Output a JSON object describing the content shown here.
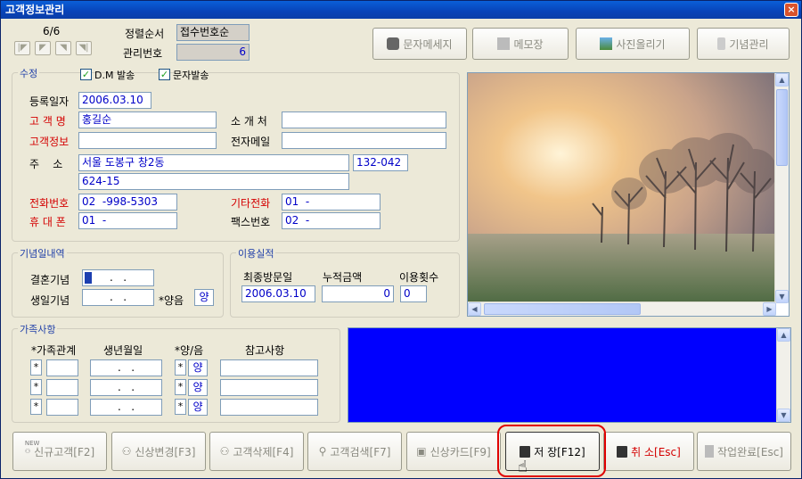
{
  "window": {
    "title": "고객정보관리",
    "close": "×"
  },
  "header": {
    "record_counter": "6/6",
    "sort_label": "정렬순서",
    "sort_value": "접수번호순",
    "manage_no_label": "관리번호",
    "manage_no_value": "6"
  },
  "toolbar": {
    "sms": "문자메세지",
    "memo": "메모장",
    "photo": "사진올리기",
    "anniv": "기념관리"
  },
  "edit": {
    "group_title": "수정",
    "dm_label": "D.M 발송",
    "sms_send_label": "문자발송",
    "reg_date_label": "등록일자",
    "reg_date": "2006.03.10",
    "name_label": "고 객 명",
    "name": "홍길순",
    "intro_label": "소 개 처",
    "intro": "",
    "info_label": "고객정보",
    "info": "",
    "email_label": "전자메일",
    "email": "",
    "addr_label": "주    소",
    "addr1": "서울 도봉구 창2동",
    "zip": "132-042",
    "addr2": "624-15",
    "phone_label": "전화번호",
    "phone": "02  -998-5303",
    "other_phone_label": "기타전화",
    "other_phone": "01  -",
    "mobile_label": "휴 대 폰",
    "mobile": "01  -",
    "fax_label": "팩스번호",
    "fax": "02  -"
  },
  "anniversary": {
    "group_title": "기념일내역",
    "wedding_label": "결혼기념",
    "wedding": ".   .",
    "birthday_label": "생일기념",
    "birthday": ".   .",
    "lunar_label": "*양음",
    "lunar": "양"
  },
  "usage": {
    "group_title": "이용실적",
    "last_visit_label": "최종방문일",
    "total_label": "누적금액",
    "count_label": "이용횟수",
    "last_visit": "2006.03.10",
    "total": "0",
    "count": "0"
  },
  "family": {
    "group_title": "가족사항",
    "col_relation": "*가족관계",
    "col_birth": "생년월일",
    "col_lunar": "*양/음",
    "col_note": "참고사항",
    "rows": [
      {
        "star": "*",
        "relation": "",
        "birth": ".   .",
        "star2": "*",
        "lunar": "양",
        "note": ""
      },
      {
        "star": "*",
        "relation": "",
        "birth": ".   .",
        "star2": "*",
        "lunar": "양",
        "note": ""
      },
      {
        "star": "*",
        "relation": "",
        "birth": ".   .",
        "star2": "*",
        "lunar": "양",
        "note": ""
      }
    ]
  },
  "bottom": {
    "new": "신규고객[F2]",
    "new_badge": "NEW",
    "change": "신상변경[F3]",
    "delete": "고객삭제[F4]",
    "search": "고객검색[F7]",
    "card": "신상카드[F9]",
    "save": "저 장[F12]",
    "cancel": "취 소[Esc]",
    "done": "작업완료[Esc]"
  },
  "colors": {
    "memo_bg": "#0000ff",
    "label_red": "#d40000",
    "value_blue": "#0000c8",
    "highlight": "#e00000"
  }
}
